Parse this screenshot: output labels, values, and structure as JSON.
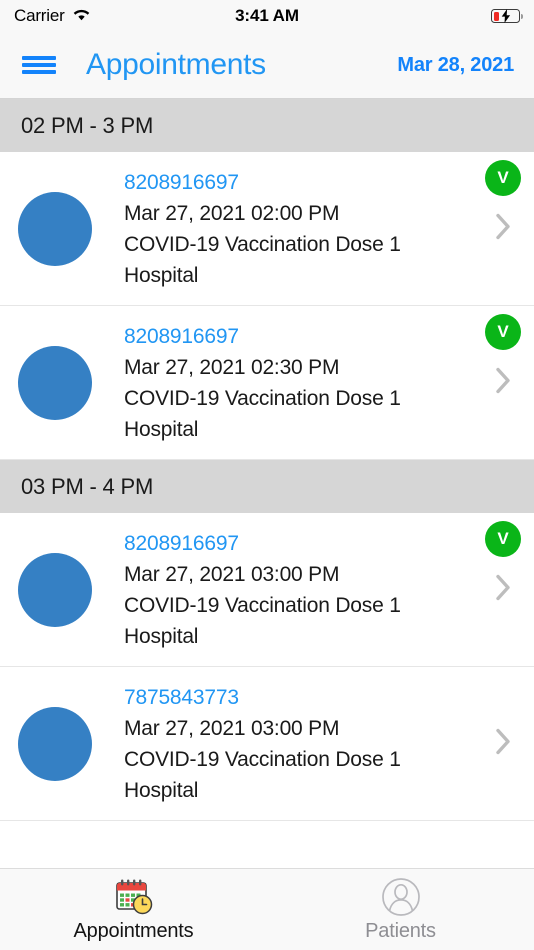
{
  "status_bar": {
    "carrier": "Carrier",
    "wifi_icon": "wifi-icon",
    "time": "3:41 AM",
    "battery_icon": "battery-charging-low-icon"
  },
  "nav_bar": {
    "menu_icon": "hamburger-menu-icon",
    "title": "Appointments",
    "date": "Mar 28, 2021",
    "title_color": "#2196f3",
    "date_color": "#1383fb"
  },
  "sections": [
    {
      "header": "02 PM - 3 PM",
      "rows": [
        {
          "phone": "8208916697",
          "datetime": "Mar 27, 2021 02:00 PM",
          "service": "COVID-19 Vaccination Dose 1",
          "location": "Hospital",
          "badge": "V",
          "has_badge": true
        },
        {
          "phone": "8208916697",
          "datetime": "Mar 27, 2021 02:30 PM",
          "service": "COVID-19 Vaccination Dose 1",
          "location": "Hospital",
          "badge": "V",
          "has_badge": true
        }
      ]
    },
    {
      "header": "03 PM - 4 PM",
      "rows": [
        {
          "phone": "8208916697",
          "datetime": "Mar 27, 2021 03:00 PM",
          "service": "COVID-19 Vaccination Dose 1",
          "location": "Hospital",
          "badge": "V",
          "has_badge": true
        },
        {
          "phone": "7875843773",
          "datetime": "Mar 27, 2021 03:00 PM",
          "service": "COVID-19 Vaccination Dose 1",
          "location": "Hospital",
          "badge": "",
          "has_badge": false
        }
      ]
    }
  ],
  "tab_bar": {
    "tabs": [
      {
        "label": "Appointments",
        "icon": "calendar-clock-icon",
        "active": true
      },
      {
        "label": "Patients",
        "icon": "person-circle-icon",
        "active": false
      }
    ]
  },
  "colors": {
    "accent_blue": "#2196f3",
    "avatar_blue": "#3580c4",
    "badge_green": "#0ab518",
    "section_grey": "#d6d6d6"
  }
}
